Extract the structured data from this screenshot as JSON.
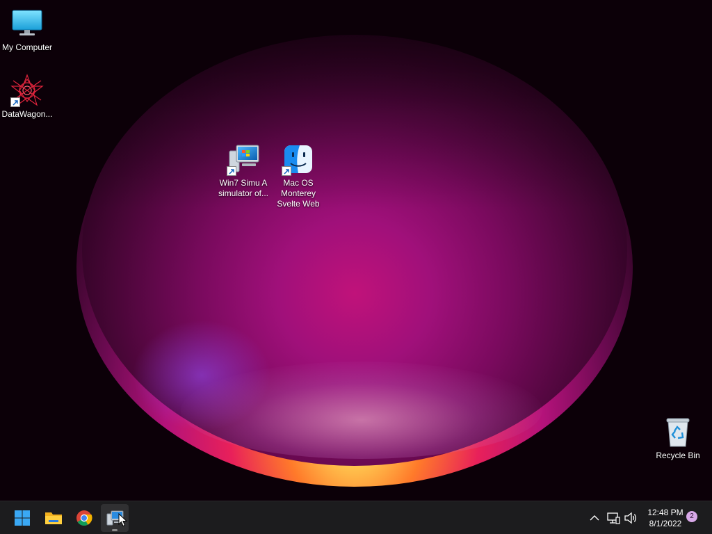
{
  "desktop": {
    "icons": [
      {
        "label": "My Computer",
        "icon": "monitor-icon"
      },
      {
        "label": "DataWagon...",
        "icon": "star-logo-icon"
      },
      {
        "label": "Win7 Simu   A\nsimulator of...",
        "icon": "computer-shortcut-icon"
      },
      {
        "label": "Mac OS\nMonterey\nSvelte Web",
        "icon": "finder-icon"
      },
      {
        "label": "Recycle Bin",
        "icon": "recycle-bin-icon"
      }
    ]
  },
  "taskbar": {
    "buttons": [
      {
        "icon": "windows-start-icon"
      },
      {
        "icon": "file-explorer-icon"
      },
      {
        "icon": "chrome-icon"
      },
      {
        "icon": "win7-simu-app-icon",
        "active": true
      }
    ],
    "tray": {
      "icons": [
        "chevron-up-icon",
        "network-icon",
        "volume-icon"
      ],
      "time": "12:48 PM",
      "date": "8/1/2022",
      "notifications": "2"
    }
  }
}
